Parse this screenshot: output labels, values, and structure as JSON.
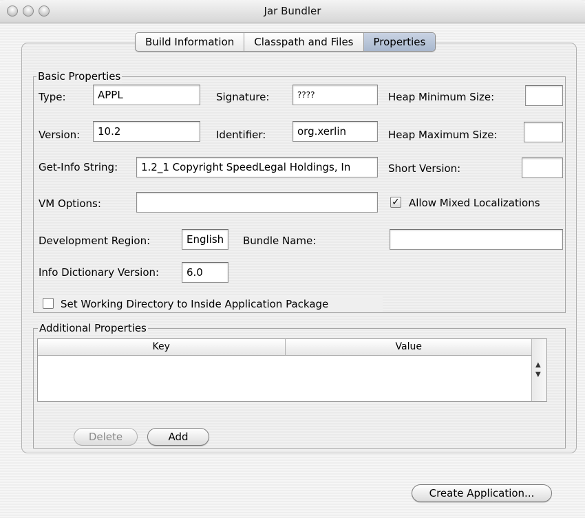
{
  "window": {
    "title": "Jar Bundler"
  },
  "tabs": [
    {
      "label": "Build Information",
      "active": false
    },
    {
      "label": "Classpath and Files",
      "active": false
    },
    {
      "label": "Properties",
      "active": true
    }
  ],
  "basic": {
    "group_label": "Basic Properties",
    "type_label": "Type:",
    "type_value": "APPL",
    "signature_label": "Signature:",
    "signature_value": "????",
    "heap_min_label": "Heap Minimum Size:",
    "heap_min_value": "",
    "version_label": "Version:",
    "version_value": "10.2",
    "identifier_label": "Identifier:",
    "identifier_value": "org.xerlin",
    "heap_max_label": "Heap Maximum Size:",
    "heap_max_value": "",
    "getinfo_label": "Get-Info String:",
    "getinfo_value": "1.2_1 Copyright SpeedLegal Holdings, In",
    "short_version_label": "Short Version:",
    "short_version_value": "",
    "vm_options_label": "VM Options:",
    "vm_options_value": "",
    "allow_mixed_label": "Allow Mixed Localizations",
    "allow_mixed_checked": "✓",
    "dev_region_label": "Development Region:",
    "dev_region_value": "English",
    "bundle_name_label": "Bundle Name:",
    "bundle_name_value": "",
    "info_dict_label": "Info Dictionary Version:",
    "info_dict_value": "6.0",
    "working_dir_label": "Set Working Directory to Inside Application Package",
    "working_dir_checked": ""
  },
  "additional": {
    "group_label": "Additional Properties",
    "columns": [
      "Key",
      "Value"
    ],
    "delete_label": "Delete",
    "add_label": "Add"
  },
  "footer": {
    "create_label": "Create Application..."
  }
}
